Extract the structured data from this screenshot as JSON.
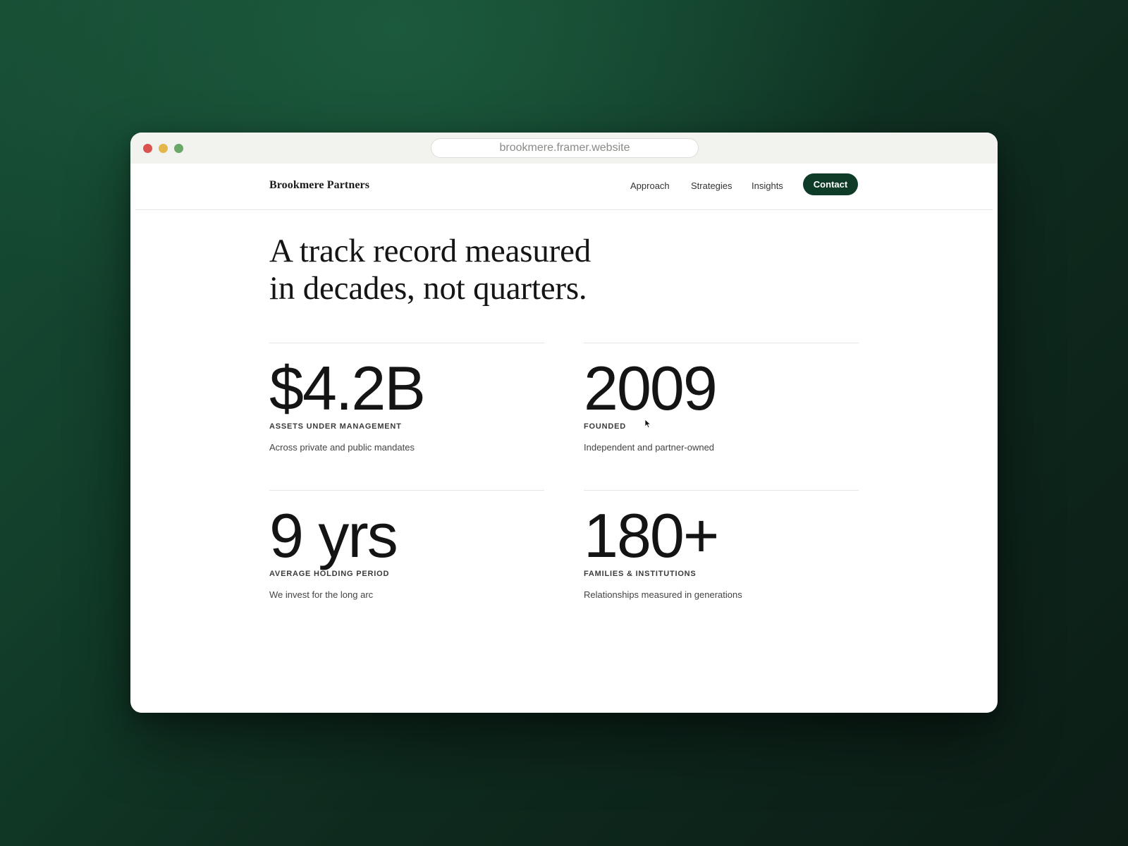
{
  "browser": {
    "url": "brookmere.framer.website"
  },
  "nav": {
    "brand": "Brookmere Partners",
    "links": [
      "Approach",
      "Strategies",
      "Insights"
    ],
    "cta": "Contact",
    "cta_color": "#0f3b29"
  },
  "hero": {
    "headline_line1": "A track record measured",
    "headline_line2": "in decades, not quarters."
  },
  "stats": [
    {
      "value": "$4.2B",
      "label": "ASSETS UNDER MANAGEMENT",
      "description": "Across private and public mandates"
    },
    {
      "value": "2009",
      "label": "FOUNDED",
      "description": "Independent and partner-owned"
    },
    {
      "value": "9 yrs",
      "label": "AVERAGE HOLDING PERIOD",
      "description": "We invest for the long arc"
    },
    {
      "value": "180+",
      "label": "FAMILIES & INSTITUTIONS",
      "description": "Relationships measured in generations"
    }
  ],
  "icons": {
    "window_controls": [
      "close-dot",
      "minimize-dot",
      "zoom-dot"
    ],
    "cursor": "arrow-cursor-icon"
  }
}
